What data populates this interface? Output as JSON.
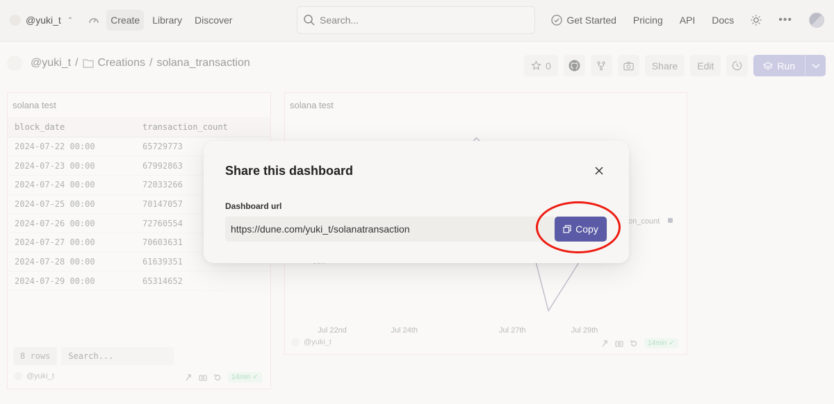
{
  "topnav": {
    "username": "@yuki_t",
    "links": [
      "Create",
      "Library",
      "Discover"
    ],
    "search_placeholder": "Search...",
    "right": {
      "get_started": "Get Started",
      "pricing": "Pricing",
      "api": "API",
      "docs": "Docs"
    }
  },
  "breadcrumb": {
    "user": "@yuki_t",
    "sep": "/",
    "folder": "Creations",
    "sep2": "/",
    "name": "solana_transaction"
  },
  "toolbar": {
    "stars": "0",
    "share": "Share",
    "edit": "Edit",
    "run": "Run"
  },
  "table_panel": {
    "title": "solana test",
    "columns": [
      "block_date",
      "transaction_count"
    ],
    "rows": [
      [
        "2024-07-22 00:00",
        "65729773"
      ],
      [
        "2024-07-23 00:00",
        "67992863"
      ],
      [
        "2024-07-24 00:00",
        "72033266"
      ],
      [
        "2024-07-25 00:00",
        "70147057"
      ],
      [
        "2024-07-26 00:00",
        "72760554"
      ],
      [
        "2024-07-27 00:00",
        "70603631"
      ],
      [
        "2024-07-28 00:00",
        "61639351"
      ],
      [
        "2024-07-29 00:00",
        "65314652"
      ]
    ],
    "row_count": "8 rows",
    "search_placeholder": "Search...",
    "owner": "@yuki_t",
    "freshness": "14min"
  },
  "chart_panel": {
    "title": "solana test",
    "owner": "@yuki_t",
    "freshness": "14min",
    "legend_fragment": "on_count",
    "y_fragment": "00M"
  },
  "chart_data": {
    "type": "line",
    "title": "solana test",
    "x": [
      "2024-07-22",
      "2024-07-23",
      "2024-07-24",
      "2024-07-25",
      "2024-07-26",
      "2024-07-27",
      "2024-07-28",
      "2024-07-29"
    ],
    "tick_labels": [
      "Jul 22nd",
      "Jul 24th",
      "Jul 27th",
      "Jul 29th"
    ],
    "series": [
      {
        "values": [
          65729773,
          67992863,
          72033266,
          70147057,
          72760554,
          70603631,
          61639351,
          65314652
        ]
      }
    ],
    "ylim": [
      61000000,
      73500000
    ],
    "line_color": "#8f8ea0"
  },
  "modal": {
    "title": "Share this dashboard",
    "url_label": "Dashboard url",
    "url": "https://dune.com/yuki_t/solanatransaction",
    "copy_label": "Copy"
  },
  "colors": {
    "copy_button": "#5a5aa6",
    "run_button": "#a6a5cf",
    "highlight_ring": "#ee1b10"
  }
}
